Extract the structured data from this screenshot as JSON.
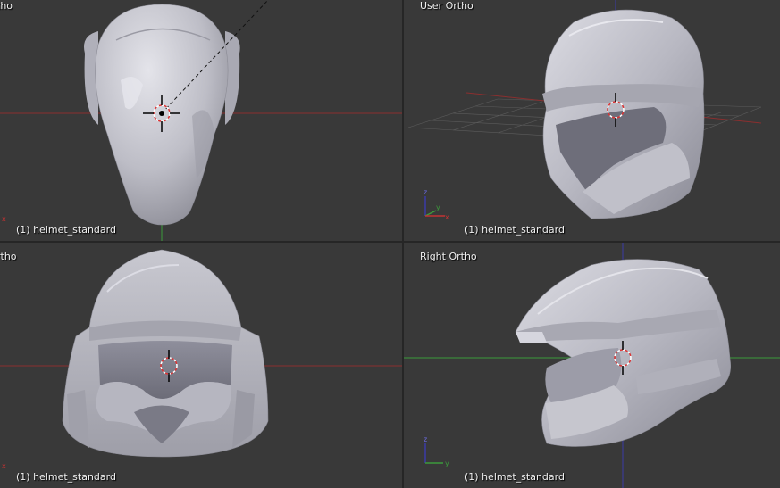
{
  "viewports": {
    "top_left": {
      "title": "tho",
      "object": "(1) helmet_standard"
    },
    "top_right": {
      "title": "User Ortho",
      "object": "(1) helmet_standard"
    },
    "bottom_left": {
      "title": "rtho",
      "object": "(1) helmet_standard"
    },
    "bottom_right": {
      "title": "Right Ortho",
      "object": "(1) helmet_standard"
    }
  },
  "axis_labels": {
    "x": "x",
    "y": "y",
    "z": "z"
  },
  "colors": {
    "background": "#393939",
    "separator": "#262626",
    "x_axis": "#c33232",
    "y_axis": "#3c9a3c",
    "z_axis": "#3a3aa8",
    "mesh": "#c9c9d1",
    "grid": "#5a5a5a"
  },
  "icons": {
    "cursor": "3d-cursor-icon",
    "gizmo": "axis-gizmo-icon"
  }
}
